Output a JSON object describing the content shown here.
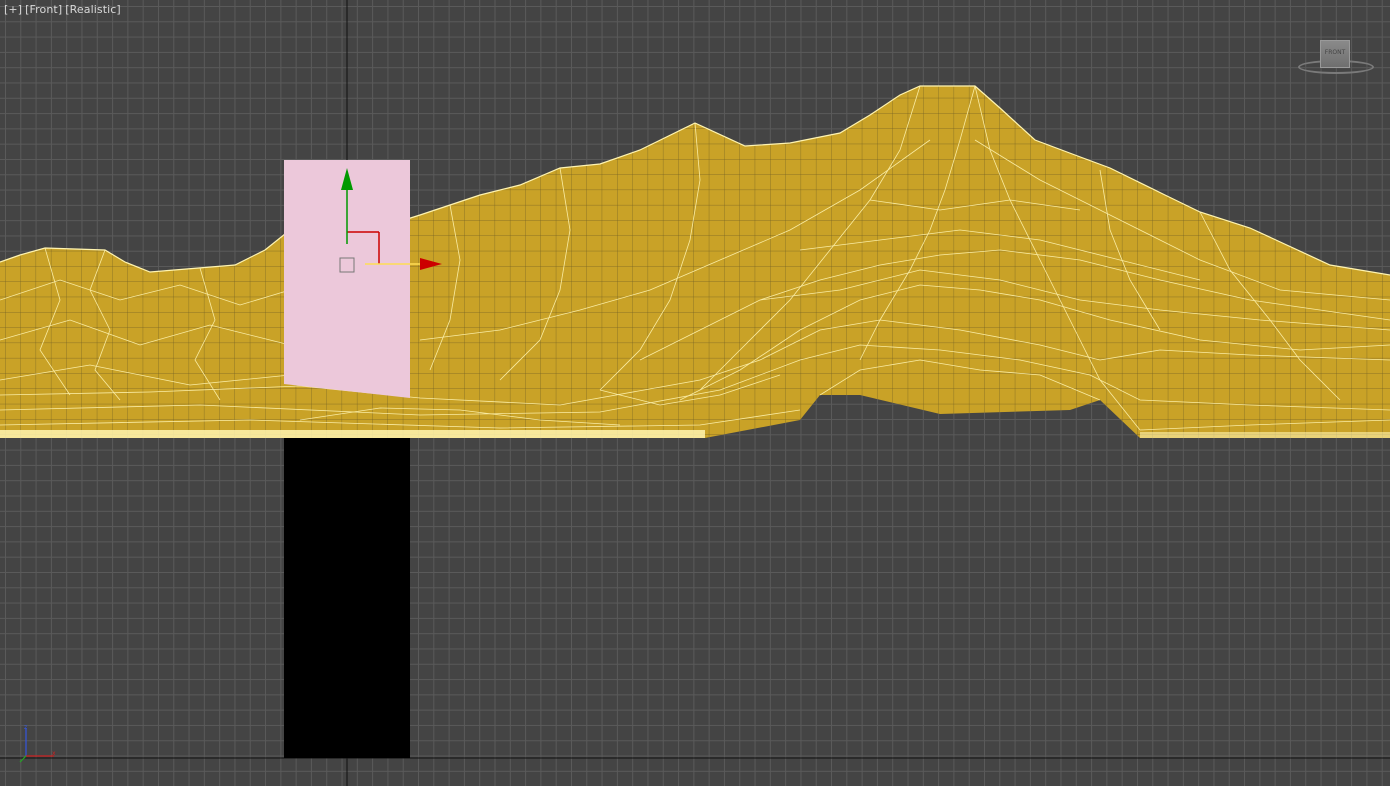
{
  "viewport": {
    "labels": [
      "[+]",
      "[Front]",
      "[Realistic]"
    ],
    "background_color": "#444444",
    "grid_color": "#5a5a5a"
  },
  "viewcube": {
    "face_label": "FRONT"
  },
  "scene": {
    "terrain_color": "#c9a227",
    "wire_color": "#fff4b0",
    "selected_box_color": "#ecc8da",
    "shadow_box_color": "#000000"
  },
  "gizmo": {
    "x_axis_color": "#cc0000",
    "y_axis_color": "#009900",
    "plane_color": "#dd2222"
  },
  "world_axis": {
    "x_color": "#cc2222",
    "y_color": "#22aa22",
    "z_color": "#3355dd"
  },
  "icons": [
    "move-gizmo-icon",
    "viewcube-icon",
    "world-axis-icon"
  ]
}
